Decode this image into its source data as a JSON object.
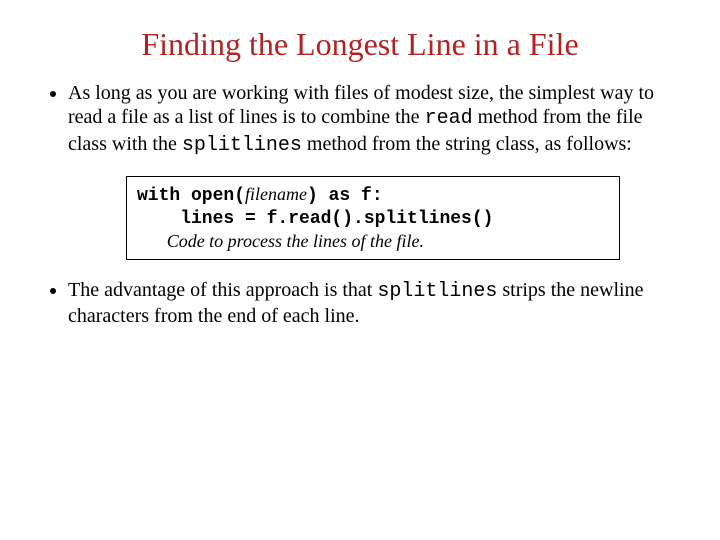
{
  "title": "Finding the Longest Line in a File",
  "bullets": {
    "b1_pre": "As long as you are working with files of modest size, the simplest way to read a file as a list of lines is to combine the ",
    "b1_code1": "read",
    "b1_mid1": " method from the file class with the ",
    "b1_code2": "splitlines",
    "b1_mid2": " method from the string class, as follows:",
    "b2_pre": "The advantage of this approach is that ",
    "b2_code1": "splitlines",
    "b2_post": " strips the newline characters from the end of each line."
  },
  "code": {
    "l1a": "with open(",
    "l1arg": "filename",
    "l1b": ") as f:",
    "l2": "    lines = f.read().splitlines()",
    "desc": "Code to process the lines of the file."
  }
}
